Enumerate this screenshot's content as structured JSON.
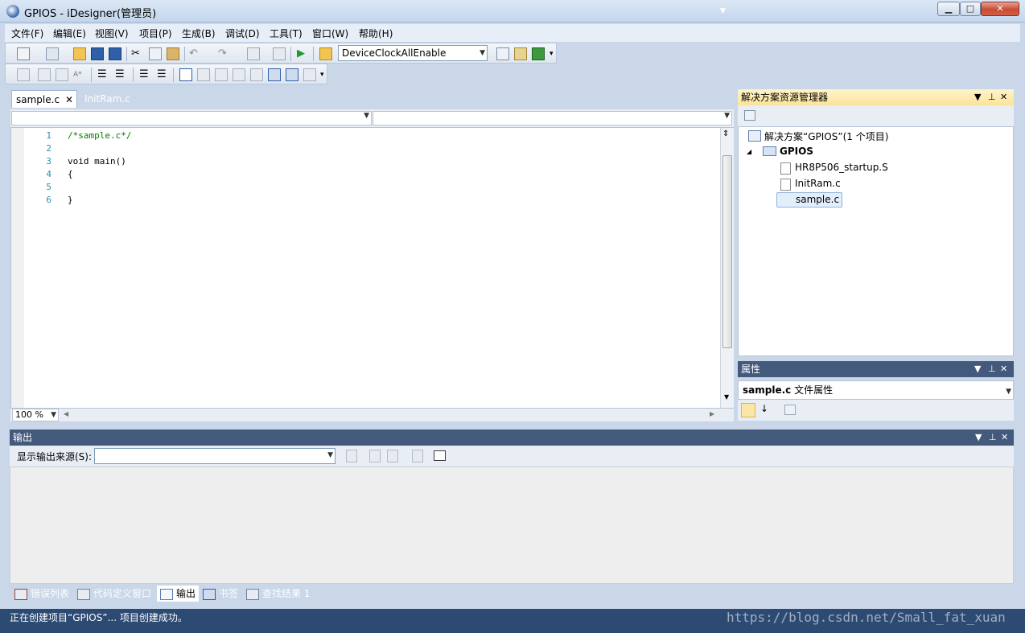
{
  "window": {
    "title": "GPIOS - iDesigner(管理员)"
  },
  "menu": [
    "文件(F)",
    "编辑(E)",
    "视图(V)",
    "项目(P)",
    "生成(B)",
    "调试(D)",
    "工具(T)",
    "窗口(W)",
    "帮助(H)"
  ],
  "toolbar": {
    "config_value": "DeviceClockAllEnable"
  },
  "editor": {
    "tabs": [
      "sample.c",
      "InitRam.c"
    ],
    "active_tab": "sample.c",
    "line_numbers": [
      "1",
      "2",
      "3",
      "4",
      "5",
      "6"
    ],
    "lines": [
      "/*sample.c*/",
      "",
      "void main()",
      "{",
      "",
      "}"
    ],
    "zoom": "100 %"
  },
  "solution_explorer": {
    "title": "解决方案资源管理器",
    "solution": "解决方案“GPIOS”(1 个项目)",
    "project": "GPIOS",
    "files": [
      "HR8P506_startup.S",
      "InitRam.c",
      "sample.c"
    ],
    "selected_file": "sample.c"
  },
  "properties": {
    "title": "属性",
    "object_name": "sample.c",
    "object_type": "文件属性"
  },
  "output": {
    "title": "输出",
    "source_label": "显示输出来源(S):",
    "source_value": ""
  },
  "bottom_tabs": [
    "错误列表",
    "代码定义窗口",
    "输出",
    "书签",
    "查找结果 1"
  ],
  "active_bottom_tab": "输出",
  "status": {
    "text": "正在创建项目“GPIOS”... 项目创建成功。"
  },
  "watermark": "https://blog.csdn.net/Small_fat_xuan",
  "colors": {
    "chrome": "#c9d7e8",
    "panel_header": "#435a7d",
    "active_panel_header": "#fbe39a",
    "status_bar": "#2d4a73",
    "comment": "#008000",
    "line_number": "#2b91af"
  }
}
